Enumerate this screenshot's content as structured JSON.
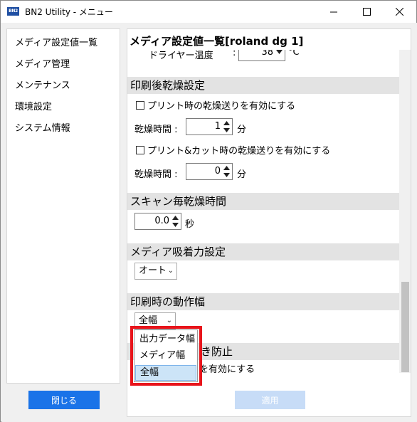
{
  "window": {
    "title": "BN2 Utility - メニュー",
    "app_icon_text": "BN2"
  },
  "sidebar": {
    "items": [
      {
        "label": "メディア設定値一覧"
      },
      {
        "label": "メディア管理"
      },
      {
        "label": "メンテナンス"
      },
      {
        "label": "環境設定"
      },
      {
        "label": "システム情報"
      }
    ],
    "close_label": "閉じる"
  },
  "main": {
    "title": "メディア設定値一覧[roland dg 1]",
    "dryer_temp": {
      "label": "ドライヤー温度",
      "colon": ":",
      "value": "38",
      "unit": "°C"
    },
    "post_print_dry": {
      "header": "印刷後乾燥設定",
      "print_dry_checkbox": {
        "label": "プリント時の乾燥送りを有効にする",
        "checked": false
      },
      "dry_time_1": {
        "label": "乾燥時間 :",
        "value": "1",
        "unit": "分"
      },
      "print_cut_dry_checkbox": {
        "label": "プリント&カット時の乾燥送りを有効にする",
        "checked": false
      },
      "dry_time_2": {
        "label": "乾燥時間 :",
        "value": "0",
        "unit": "分"
      }
    },
    "scan_dry": {
      "header": "スキャン毎乾燥時間",
      "value": "0.0",
      "unit": "秒"
    },
    "suction": {
      "header": "メディア吸着力設定",
      "selected": "オート"
    },
    "print_width": {
      "header": "印刷時の動作幅",
      "selected": "全幅"
    },
    "prevent": {
      "header_visible": "き防止",
      "checkbox_text_visible": "を有効にする"
    },
    "apply_label": "適用"
  },
  "dropdown": {
    "options": [
      {
        "label": "出力データ幅",
        "selected": false
      },
      {
        "label": "メディア幅",
        "selected": false
      },
      {
        "label": "全幅",
        "selected": true
      }
    ]
  },
  "colors": {
    "accent": "#1a73e8",
    "apply_disabled": "#c7dcf7",
    "highlight": "#e8141b",
    "selected_option": "#cce4f7",
    "section_header": "#e3e3e3"
  }
}
